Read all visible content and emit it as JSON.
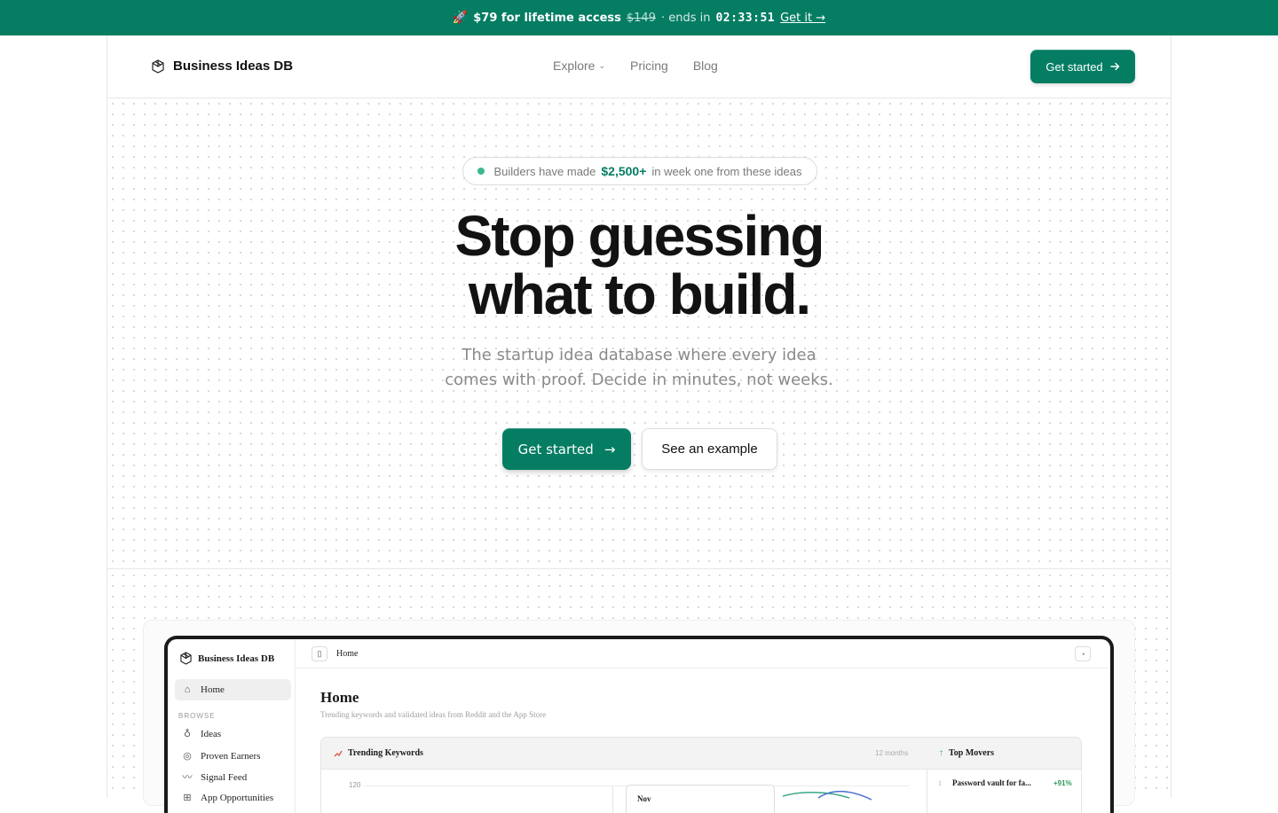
{
  "promo": {
    "rocket": "🚀",
    "offer": "$79 for lifetime access",
    "old_price": "$149",
    "ends_label": "· ends in",
    "timer": "02:33:51",
    "link": "Get it →"
  },
  "nav": {
    "brand": "Business Ideas DB",
    "links": [
      {
        "label": "Explore",
        "icon": "chevron-down-icon"
      },
      {
        "label": "Pricing"
      },
      {
        "label": "Blog"
      }
    ],
    "cta": "Get started"
  },
  "hero": {
    "pill_prefix": "Builders have made",
    "pill_amount": "$2,500+",
    "pill_suffix": "in week one from these ideas",
    "headline_line1": "Stop guessing",
    "headline_line2": "what to build.",
    "subtitle": "The startup idea database where every idea comes with proof. Decide in minutes, not weeks.",
    "primary_cta": "Get started",
    "primary_cta_arrow": "→",
    "secondary_cta": "See an example"
  },
  "preview": {
    "brand": "Business Ideas DB",
    "sidebar": {
      "home": "Home",
      "section": "BROWSE",
      "items": [
        "Ideas",
        "Proven Earners",
        "Signal Feed",
        "App Opportunities"
      ]
    },
    "topbar_title": "Home",
    "page_title": "Home",
    "page_subtitle": "Trending keywords and validated ideas from Reddit and the App Store",
    "trending": {
      "title": "Trending Keywords",
      "range": "12 months",
      "y_tick": "120",
      "tooltip_label": "Nov"
    },
    "movers": {
      "title": "Top Movers",
      "rows": [
        {
          "rank": "1",
          "name": "Password vault for fa...",
          "change": "+91%"
        }
      ]
    }
  },
  "colors": {
    "brand_green": "#047d63",
    "accent_green": "#3cb98e",
    "highlight": "#d8efe7",
    "positive": "#2d9b5f"
  }
}
